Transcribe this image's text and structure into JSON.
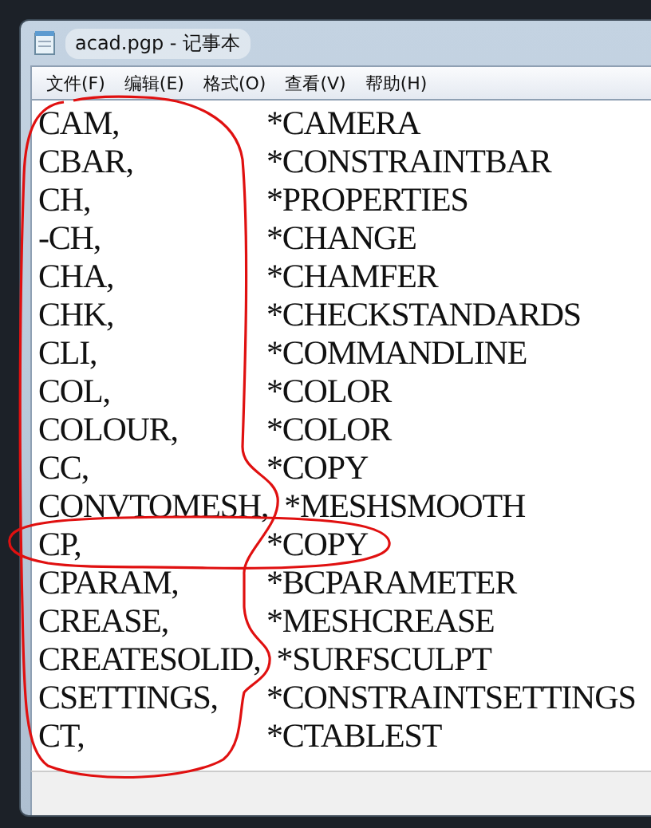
{
  "window": {
    "title": "acad.pgp - 记事本"
  },
  "menu": [
    "文件(F)",
    "编辑(E)",
    "格式(O)",
    "查看(V)",
    "帮助(H)"
  ],
  "lines": [
    {
      "alias": "CAM,",
      "command": "*CAMERA"
    },
    {
      "alias": "CBAR,",
      "command": "*CONSTRAINTBAR"
    },
    {
      "alias": "CH,",
      "command": "*PROPERTIES"
    },
    {
      "alias": "-CH,",
      "command": "*CHANGE"
    },
    {
      "alias": "CHA,",
      "command": "*CHAMFER"
    },
    {
      "alias": "CHK,",
      "command": "*CHECKSTANDARDS"
    },
    {
      "alias": "CLI,",
      "command": "*COMMANDLINE"
    },
    {
      "alias": "COL,",
      "command": "*COLOR"
    },
    {
      "alias": "COLOUR,",
      "command": "*COLOR"
    },
    {
      "alias": "CC,",
      "command": "*COPY"
    },
    {
      "alias": "CONVTOMESH,",
      "command": "*MESHSMOOTH"
    },
    {
      "alias": "CP,",
      "command": "*COPY"
    },
    {
      "alias": "CPARAM,",
      "command": "*BCPARAMETER"
    },
    {
      "alias": "CREASE,",
      "command": "*MESHCREASE"
    },
    {
      "alias": "CREATESOLID,",
      "command": "*SURFSCULPT"
    },
    {
      "alias": "CSETTINGS,",
      "command": "*CONSTRAINTSETTINGS"
    },
    {
      "alias": "CT,",
      "command": "*CTABLEST"
    }
  ]
}
